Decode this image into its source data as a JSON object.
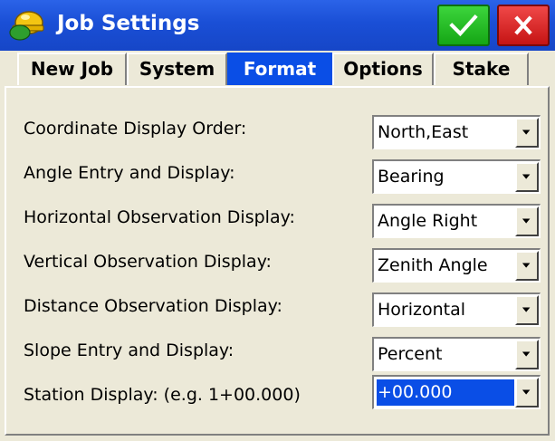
{
  "window": {
    "title": "Job Settings",
    "app_icon": "helmet-icon",
    "ok_icon": "checkmark-icon",
    "close_icon": "close-icon"
  },
  "tabs": [
    {
      "label": "New Job",
      "active": false
    },
    {
      "label": "System",
      "active": false
    },
    {
      "label": "Format",
      "active": true
    },
    {
      "label": "Options",
      "active": false
    },
    {
      "label": "Stake",
      "active": false
    }
  ],
  "settings": [
    {
      "label": "Coordinate Display Order:",
      "value": "North,East"
    },
    {
      "label": "Angle Entry and Display:",
      "value": "Bearing"
    },
    {
      "label": "Horizontal Observation Display:",
      "value": "Angle Right"
    },
    {
      "label": "Vertical Observation Display:",
      "value": "Zenith Angle"
    },
    {
      "label": "Distance Observation Display:",
      "value": "Horizontal"
    },
    {
      "label": "Slope Entry and Display:",
      "value": "Percent"
    },
    {
      "label": "Station Display: (e.g. 1+00.000)",
      "value": "+00.000",
      "selected": true
    }
  ],
  "colors": {
    "title_bar": "#1a4fd6",
    "active_tab": "#0a4ee6",
    "ok_button": "#15a615",
    "close_button": "#c51414",
    "background": "#ece9d8"
  }
}
